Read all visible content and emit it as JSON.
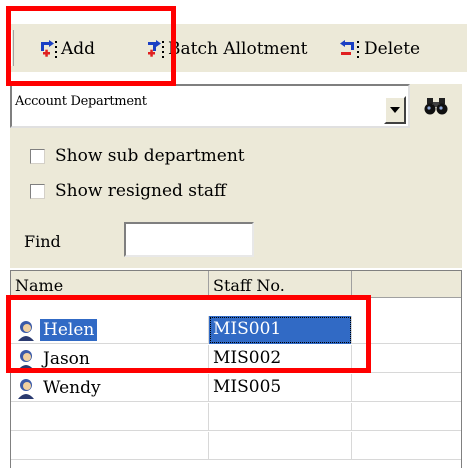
{
  "toolbar": {
    "add_label": "Add",
    "batch_label": "Batch Allotment",
    "delete_label": "Delete"
  },
  "department": {
    "selected": "Account Department"
  },
  "options": {
    "show_sub_department": "Show sub department",
    "show_resigned_staff": "Show resigned staff",
    "find_label": "Find",
    "find_value": ""
  },
  "list": {
    "columns": [
      "Name",
      "Staff No."
    ],
    "rows": [
      {
        "name": "Helen",
        "staff_no": "MIS001",
        "selected": true
      },
      {
        "name": "Jason",
        "staff_no": "MIS002",
        "selected": false
      },
      {
        "name": "Wendy",
        "staff_no": "MIS005",
        "selected": false
      }
    ]
  },
  "colors": {
    "selection": "#316ac5",
    "annotation": "#ff0000",
    "panel": "#ece9d8"
  }
}
